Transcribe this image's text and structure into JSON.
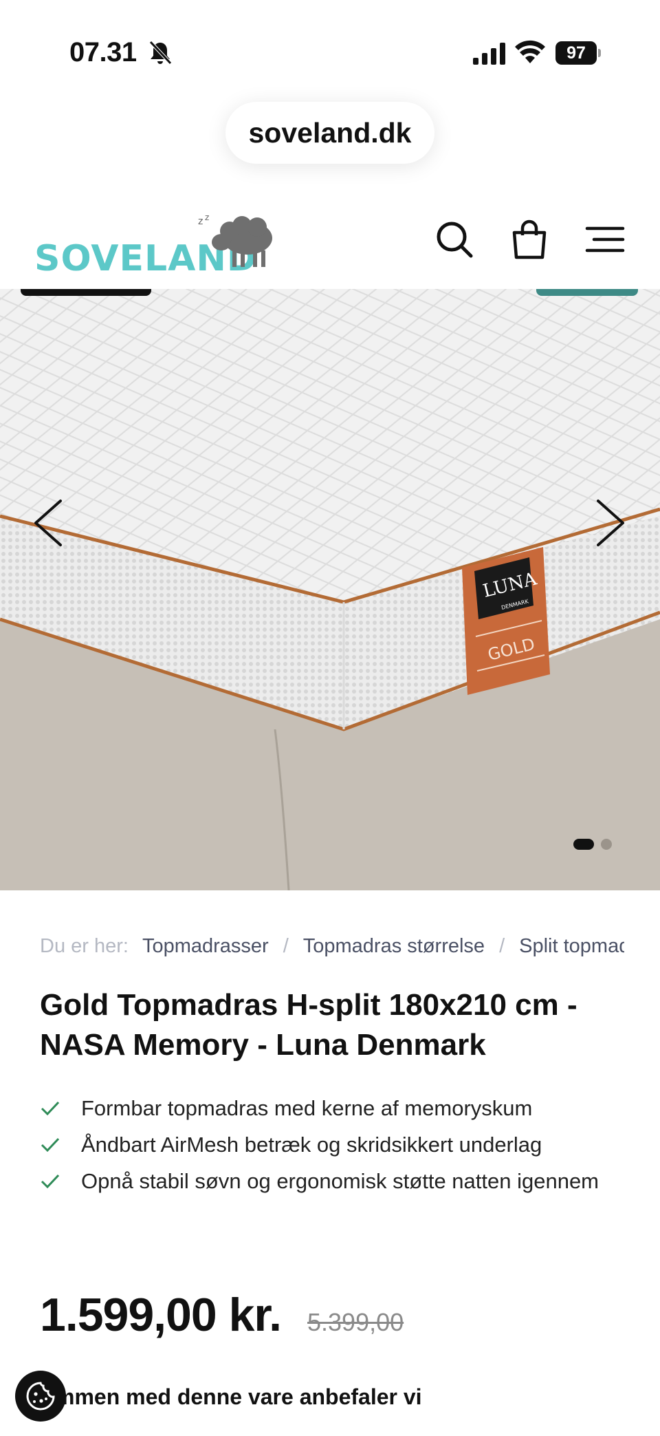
{
  "status_bar": {
    "time": "07.31",
    "battery": "97"
  },
  "browser": {
    "url": "soveland.dk"
  },
  "header": {
    "logo_text": "SOVELAND",
    "logo_zz": "z z"
  },
  "hero": {
    "label_brand": "LUNA",
    "label_sub": "DENMARK",
    "label_product": "GOLD"
  },
  "breadcrumb": {
    "prefix": "Du er her:",
    "items": [
      "Topmadrasser",
      "Topmadras størrelse",
      "Split topmadrasser"
    ],
    "separator": "/"
  },
  "product": {
    "title": "Gold Topmadras H-split 180x210 cm - NASA Memory - Luna Denmark",
    "features": [
      "Formbar topmadras med kerne af memoryskum",
      "Åndbart AirMesh betræk og skridsikkert underlag",
      "Opnå stabil søvn og ergonomisk støtte natten igennem"
    ],
    "price": "1.599,00 kr.",
    "old_price": "5.399,00"
  },
  "recommend": {
    "heading": "Sammen med denne vare anbefaler vi",
    "visible_heading": "mmen med denne vare anbefaler vi"
  },
  "colors": {
    "brand_teal": "#5cc8c8",
    "check_green": "#2e8b57",
    "text_dark": "#111111",
    "muted": "#b4b8c2"
  }
}
